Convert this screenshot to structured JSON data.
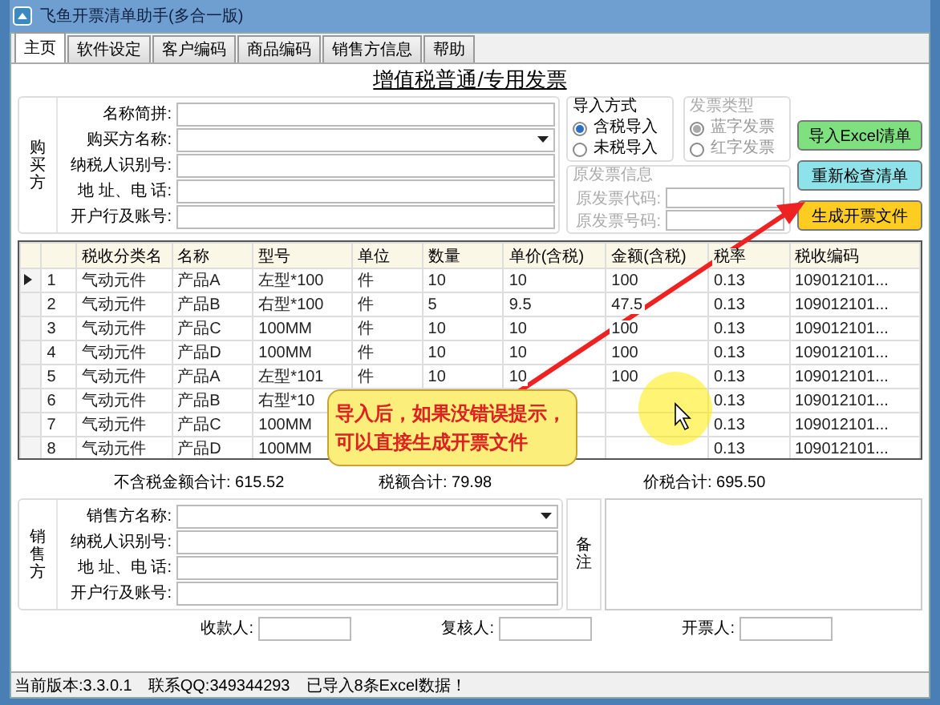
{
  "window": {
    "title": "飞鱼开票清单助手(多合一版)"
  },
  "tabs": [
    {
      "label": "主页",
      "selected": true
    },
    {
      "label": "软件设定",
      "selected": false
    },
    {
      "label": "客户编码",
      "selected": false
    },
    {
      "label": "商品编码",
      "selected": false
    },
    {
      "label": "销售方信息",
      "selected": false
    },
    {
      "label": "帮助",
      "selected": false
    }
  ],
  "invoice_title": "增值税普通/专用发票",
  "buyer": {
    "side_label": "购买方",
    "fields": [
      {
        "label": "名称简拼:",
        "kind": "text"
      },
      {
        "label": "购买方名称:",
        "kind": "dropdown"
      },
      {
        "label": "纳税人识别号:",
        "kind": "text"
      },
      {
        "label": "地 址、电 话:",
        "kind": "text"
      },
      {
        "label": "开户行及账号:",
        "kind": "text"
      }
    ]
  },
  "import_mode": {
    "title": "导入方式",
    "disabled": false,
    "options": [
      {
        "label": "含税导入",
        "selected": true
      },
      {
        "label": "未税导入",
        "selected": false
      }
    ]
  },
  "invoice_type": {
    "title": "发票类型",
    "disabled": true,
    "options": [
      {
        "label": "蓝字发票",
        "selected": true
      },
      {
        "label": "红字发票",
        "selected": false
      }
    ]
  },
  "original_invoice": {
    "title": "原发票信息",
    "disabled": true,
    "fields": [
      "原发票代码:",
      "原发票号码:"
    ]
  },
  "buttons": [
    {
      "label": "导入Excel清单",
      "color": "#7fe07f"
    },
    {
      "label": "重新检查清单",
      "color": "#8ee3ea"
    },
    {
      "label": "生成开票文件",
      "color": "#ffcc22"
    }
  ],
  "table": {
    "columns": [
      "",
      "税收分类名",
      "名称",
      "型号",
      "单位",
      "数量",
      "单价(含税)",
      "金额(含税)",
      "税率",
      "税收编码"
    ],
    "rows": [
      {
        "current": true,
        "cells": [
          "1",
          "气动元件",
          "产品A",
          "左型*100",
          "件",
          "10",
          "10",
          "100",
          "0.13",
          "109012101..."
        ]
      },
      {
        "current": false,
        "cells": [
          "2",
          "气动元件",
          "产品B",
          "右型*100",
          "件",
          "5",
          "9.5",
          "47.5",
          "0.13",
          "109012101..."
        ]
      },
      {
        "current": false,
        "cells": [
          "3",
          "气动元件",
          "产品C",
          "100MM",
          "件",
          "10",
          "10",
          "100",
          "0.13",
          "109012101..."
        ]
      },
      {
        "current": false,
        "cells": [
          "4",
          "气动元件",
          "产品D",
          "100MM",
          "件",
          "10",
          "10",
          "100",
          "0.13",
          "109012101..."
        ]
      },
      {
        "current": false,
        "cells": [
          "5",
          "气动元件",
          "产品A",
          "左型*101",
          "件",
          "10",
          "10",
          "100",
          "0.13",
          "109012101..."
        ]
      },
      {
        "current": false,
        "cells": [
          "6",
          "气动元件",
          "产品B",
          "右型*10",
          null,
          null,
          null,
          null,
          "0.13",
          "109012101..."
        ]
      },
      {
        "current": false,
        "cells": [
          "7",
          "气动元件",
          "产品C",
          "100MM",
          null,
          null,
          null,
          null,
          "0.13",
          "109012101..."
        ]
      },
      {
        "current": false,
        "cells": [
          "8",
          "气动元件",
          "产品D",
          "100MM",
          null,
          null,
          null,
          null,
          "0.13",
          "109012101..."
        ]
      }
    ]
  },
  "totals": [
    "不含税金额合计: 615.52",
    "税额合计: 79.98",
    "价税合计: 695.50"
  ],
  "seller": {
    "side_label": "销售方",
    "fields": [
      {
        "label": "销售方名称:",
        "kind": "dropdown"
      },
      {
        "label": "纳税人识别号:",
        "kind": "text"
      },
      {
        "label": "地 址、电 话:",
        "kind": "text"
      },
      {
        "label": "开户行及账号:",
        "kind": "text"
      }
    ]
  },
  "remark": {
    "label": "备注"
  },
  "signers": [
    "收款人:",
    "复核人:",
    "开票人:"
  ],
  "status_bar": [
    "当前版本:3.3.0.1",
    "联系QQ:349344293",
    "已导入8条Excel数据！"
  ],
  "callout": {
    "text": "导入后，如果没错误提示，可以直接生成开票文件"
  }
}
